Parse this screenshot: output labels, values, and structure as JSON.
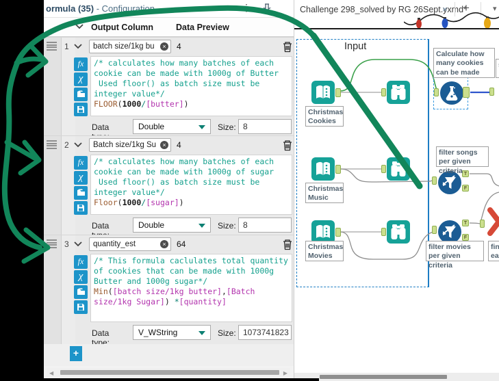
{
  "colors": {
    "alteryx_teal": "#16a298",
    "tool_blue": "#1b5c94",
    "anchor_green": "#cbdf8e",
    "container_blue": "#1d7dc4",
    "selected_wire_blue": "#2f55cc",
    "highlight_wire_green": "#3aa04a",
    "annotation_green": "#12865a",
    "red_tool": "#d64937",
    "icon_button_blue": "#1d94c9",
    "code_comment": "#14a08d",
    "code_function": "#9a5b2f",
    "code_field": "#b233ad",
    "code_operator": "#0c8073"
  },
  "config": {
    "title": "ormula (35)",
    "title_suffix": " - Configuration",
    "menu_dots": "⋮",
    "columns": {
      "output": "Output Column",
      "preview": "Data Preview"
    },
    "add_button": "+",
    "rows": [
      {
        "num": "1",
        "name": "batch size/1kg bu",
        "remove": "×",
        "preview": "4",
        "code": [
          {
            "c": "cm",
            "t": "/* calculates how many batches of each\ncookie can be made with 1000g of Butter\n Used floor() as batch size must be\ninteger value*/\n"
          },
          {
            "c": "fn",
            "t": "FLOOR"
          },
          {
            "c": "pl",
            "t": "("
          },
          {
            "c": "num",
            "t": "1000"
          },
          {
            "c": "op",
            "t": "/"
          },
          {
            "c": "fld",
            "t": "[butter]"
          },
          {
            "c": "pl",
            "t": ")"
          }
        ],
        "data_type_label": "Data type:",
        "data_type": "Double",
        "size_label": "Size:",
        "size": "8"
      },
      {
        "num": "2",
        "name": "Batch size/1kg Su",
        "remove": "×",
        "preview": "4",
        "code": [
          {
            "c": "cm",
            "t": "/* calculates how many batches of each\ncookie can be made with 1000g of sugar\n Used floor() as batch size must be\ninteger value*/\n"
          },
          {
            "c": "fn",
            "t": "Floor"
          },
          {
            "c": "pl",
            "t": "("
          },
          {
            "c": "num",
            "t": "1000"
          },
          {
            "c": "op",
            "t": "/"
          },
          {
            "c": "fld",
            "t": "[sugar]"
          },
          {
            "c": "pl",
            "t": ")"
          }
        ],
        "data_type_label": "Data type:",
        "data_type": "Double",
        "size_label": "Size:",
        "size": "8"
      },
      {
        "num": "3",
        "name": "quantity_est",
        "remove": "×",
        "preview": "64",
        "code": [
          {
            "c": "cm",
            "t": "/* This formula caclulates total quantity\nof cookies that can be made with 1000g\nButter and 1000g sugar*/\n"
          },
          {
            "c": "fn",
            "t": "Min"
          },
          {
            "c": "pl",
            "t": "("
          },
          {
            "c": "fld",
            "t": "[batch size/1kg butter]"
          },
          {
            "c": "pl",
            "t": ","
          },
          {
            "c": "fld",
            "t": "[Batch\nsize/1kg Sugar]"
          },
          {
            "c": "pl",
            "t": ") "
          },
          {
            "c": "op",
            "t": "*"
          },
          {
            "c": "fld",
            "t": "[quantity]"
          }
        ],
        "data_type_label": "Data type:",
        "data_type": "V_WString",
        "size_label": "Size:",
        "size": "1073741823"
      }
    ]
  },
  "canvas": {
    "tab": {
      "title": "Challenge 298_solved by RG 26Sept.yxmd*",
      "close": "×",
      "new_tab": "+",
      "more": "▾"
    },
    "container_label": "Input",
    "comments": {
      "cookies": "Christmas Cookies",
      "music": "Christmas Music",
      "movies": "Christmas Movies",
      "formula": "Calculate how many cookies can be made",
      "filter_songs": "filter songs per given criteria",
      "filter_movies": "filter movies per given criteria",
      "partial_right_top": "s",
      "partial_right_bottom": "find each"
    },
    "anchors": {
      "true_label": "T",
      "false_label": "F"
    }
  }
}
